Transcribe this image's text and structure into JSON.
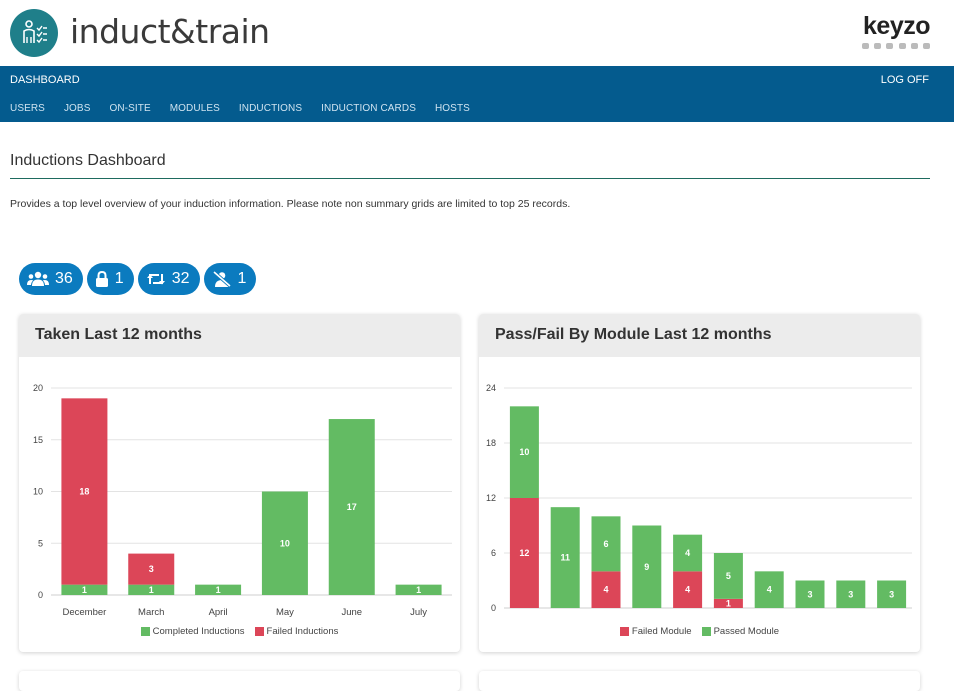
{
  "header": {
    "app_name": "induct&train",
    "brand": "keyzo"
  },
  "nav": {
    "dashboard_label": "DASHBOARD",
    "logoff_label": "LOG OFF",
    "links": [
      "USERS",
      "JOBS",
      "ON-SITE",
      "MODULES",
      "INDUCTIONS",
      "INDUCTION CARDS",
      "HOSTS"
    ]
  },
  "page": {
    "title": "Inductions Dashboard",
    "description": "Provides a top level overview of your induction information. Please note non summary grids are limited to top 25 records."
  },
  "badges": [
    {
      "icon": "users-icon",
      "value": "36"
    },
    {
      "icon": "lock-icon",
      "value": "1"
    },
    {
      "icon": "retweet-icon",
      "value": "32"
    },
    {
      "icon": "user-slash-icon",
      "value": "1"
    }
  ],
  "colors": {
    "nav_bg": "#045b8e",
    "badge_bg": "#0b7bbf",
    "passed": "#63bb63",
    "failed": "#dc4658"
  },
  "chart_data": [
    {
      "type": "bar",
      "stacked": true,
      "title": "Taken Last 12 months",
      "categories": [
        "December",
        "March",
        "April",
        "May",
        "June",
        "July"
      ],
      "ylim": [
        0,
        20
      ],
      "yticks": [
        0,
        5,
        10,
        15,
        20
      ],
      "series": [
        {
          "name": "Completed Inductions",
          "color": "#63bb63",
          "values": [
            1,
            1,
            1,
            10,
            17,
            1
          ]
        },
        {
          "name": "Failed Inductions",
          "color": "#dc4658",
          "values": [
            18,
            3,
            0,
            0,
            0,
            0
          ]
        }
      ],
      "legend": "bottom",
      "grid": true
    },
    {
      "type": "bar",
      "stacked": true,
      "title": "Pass/Fail By Module Last 12 months",
      "categories": [
        "",
        "",
        "",
        "",
        "",
        "",
        "",
        "",
        "",
        ""
      ],
      "ylim": [
        0,
        24
      ],
      "yticks": [
        0,
        6,
        12,
        18,
        24
      ],
      "series": [
        {
          "name": "Failed Module",
          "color": "#dc4658",
          "values": [
            12,
            0,
            4,
            0,
            4,
            1,
            0,
            0,
            0,
            0
          ]
        },
        {
          "name": "Passed Module",
          "color": "#63bb63",
          "values": [
            10,
            11,
            6,
            9,
            4,
            5,
            4,
            3,
            3,
            3
          ]
        }
      ],
      "legend": "bottom",
      "grid": true
    }
  ]
}
